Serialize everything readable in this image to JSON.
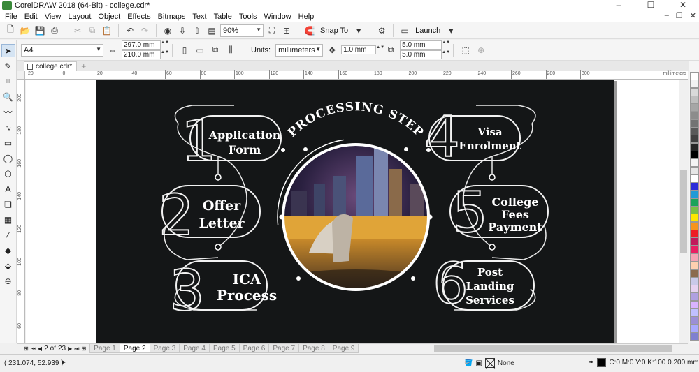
{
  "window": {
    "title": "CorelDRAW 2018 (64-Bit) - college.cdr*",
    "controls": [
      "–",
      "☐",
      "✕"
    ]
  },
  "menu": [
    "File",
    "Edit",
    "View",
    "Layout",
    "Object",
    "Effects",
    "Bitmaps",
    "Text",
    "Table",
    "Tools",
    "Window",
    "Help"
  ],
  "toolbar": {
    "zoom": "90%",
    "snap_to": "Snap To",
    "launch": "Launch"
  },
  "property_bar": {
    "page_size": "A4",
    "width": "297.0 mm",
    "height": "210.0 mm",
    "units_label": "Units:",
    "units": "millimeters",
    "nudge": "1.0 mm",
    "dup_x": "5.0 mm",
    "dup_y": "5.0 mm"
  },
  "document_tab": "college.cdr*",
  "ruler": {
    "h_labels": [
      "20",
      "0",
      "20",
      "40",
      "60",
      "80",
      "100",
      "120",
      "140",
      "160",
      "180",
      "200",
      "220",
      "240",
      "260",
      "280",
      "300"
    ],
    "v_labels": [
      "200",
      "180",
      "160",
      "140",
      "120",
      "100",
      "80",
      "60",
      "40"
    ],
    "units": "millimeters"
  },
  "design": {
    "center_title": "PROCESSING STEP",
    "steps": [
      {
        "num": "1",
        "line1": "Application",
        "line2": "Form",
        "line3": ""
      },
      {
        "num": "2",
        "line1": "Offer",
        "line2": "Letter",
        "line3": ""
      },
      {
        "num": "3",
        "line1": "ICA",
        "line2": "Process",
        "line3": ""
      },
      {
        "num": "4",
        "line1": "Visa",
        "line2": "Enrolment",
        "line3": ""
      },
      {
        "num": "5",
        "line1": "College",
        "line2": "Fees",
        "line3": "Payment"
      },
      {
        "num": "6",
        "line1": "Post",
        "line2": "Landing",
        "line3": "Services"
      }
    ]
  },
  "pager": {
    "current": "2",
    "of": "of",
    "total": "23",
    "pages": [
      "Page 1",
      "Page 2",
      "Page 3",
      "Page 4",
      "Page 5",
      "Page 6",
      "Page 7",
      "Page 8",
      "Page 9"
    ],
    "active": "Page 2"
  },
  "palette": [
    "#ffffff",
    "#f2f2f2",
    "#d9d9d9",
    "#bfbfbf",
    "#a6a6a6",
    "#8c8c8c",
    "#737373",
    "#595959",
    "#404040",
    "#262626",
    "#000000",
    "#f4f4f4",
    "#e6e6e6",
    "#ffffff",
    "#2b2bd9",
    "#1f9ad6",
    "#1ba35a",
    "#7bc043",
    "#ffe600",
    "#f7941d",
    "#ed1c24",
    "#c2185b",
    "#e91e63",
    "#f5a3b5",
    "#ffd0b0",
    "#8b6b4e",
    "#c9c9e8",
    "#e6d2f0",
    "#b0a0e0",
    "#d9b3ff",
    "#c0c0ff",
    "#9c8fd6",
    "#a9a9ff",
    "#8080d0"
  ],
  "status": {
    "coords": "( 231.074, 52.939 )",
    "fill": "None",
    "outline": "C:0 M:0 Y:0 K:100  0.200 mm"
  }
}
